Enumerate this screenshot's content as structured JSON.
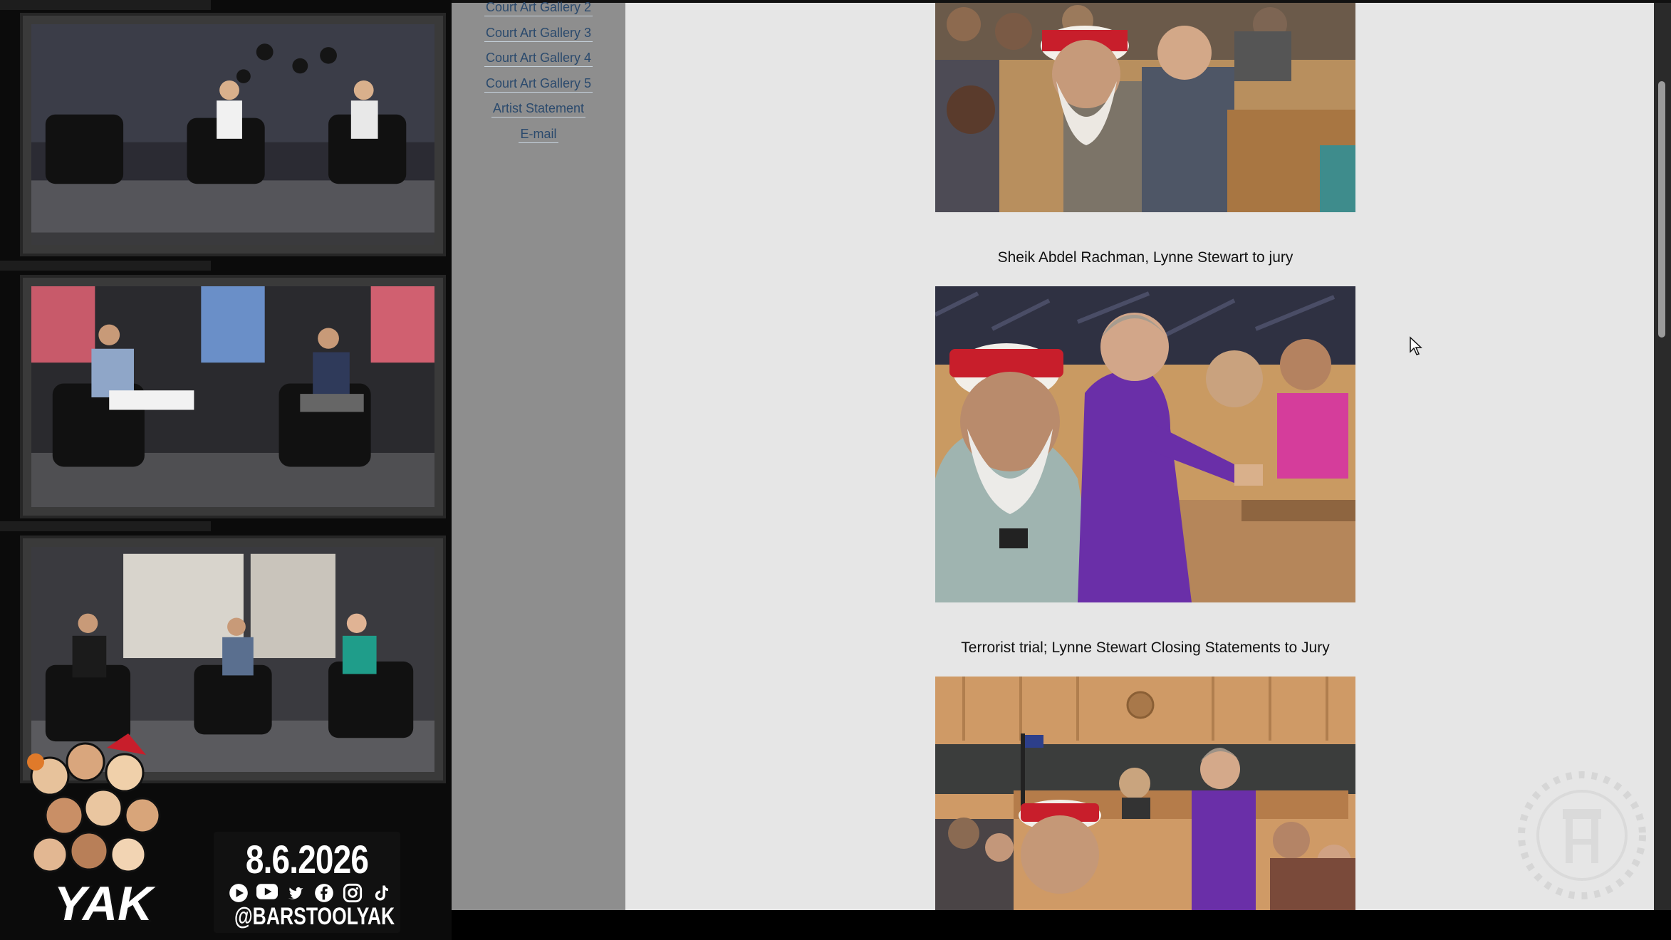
{
  "stream": {
    "date": "8.6.2026",
    "handle": "@BARSTOOLYAK",
    "logo_text": "YAK",
    "social_icons": [
      "play-icon",
      "youtube-icon",
      "twitter-icon",
      "facebook-icon",
      "instagram-icon",
      "tiktok-icon"
    ]
  },
  "browser": {
    "nav": [
      {
        "label": "Court Art Gallery 2"
      },
      {
        "label": "Court Art Gallery 3"
      },
      {
        "label": "Court Art Gallery 4"
      },
      {
        "label": "Court Art Gallery 5"
      },
      {
        "label": "Artist Statement"
      },
      {
        "label": "E-mail"
      }
    ],
    "captions": [
      "Sheik Abdel Rachman, Lynne Stewart to jury",
      "Terrorist trial; Lynne Stewart Closing Statements to Jury"
    ]
  },
  "colors": {
    "sidebar_bg": "#8e8e8e",
    "nav_link": "#2b4a6d",
    "content_bg": "#e6e6e6",
    "turban_red": "#c81e2b",
    "robe_purple": "#6a2fa8"
  }
}
